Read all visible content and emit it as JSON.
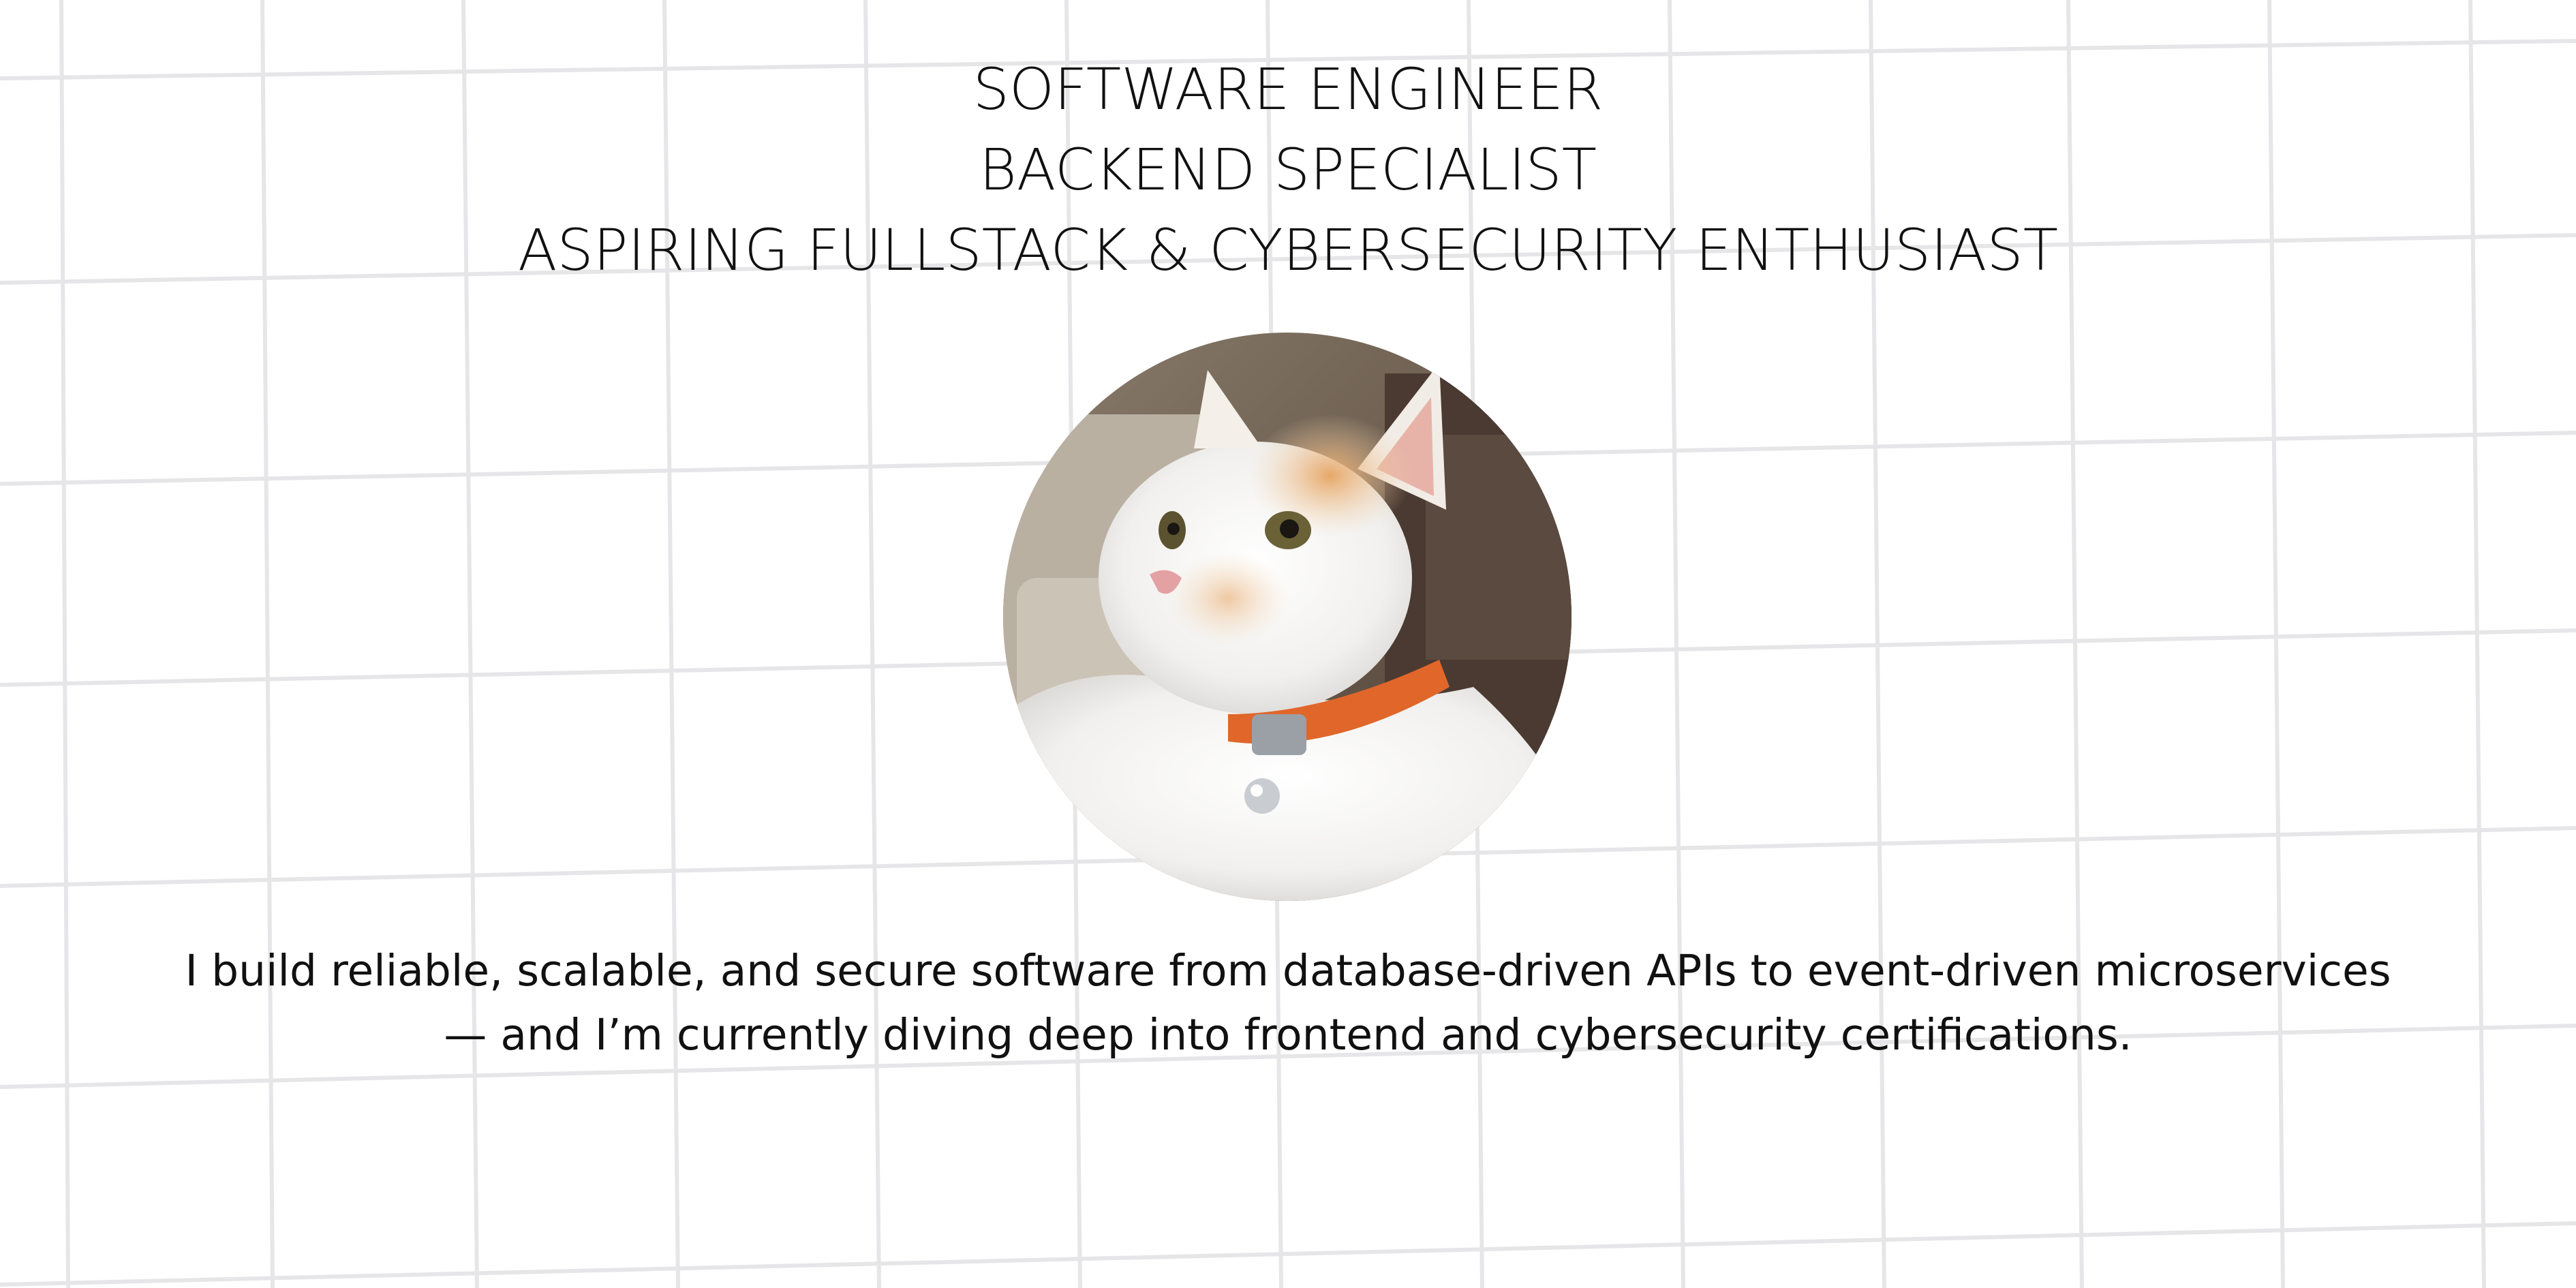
{
  "headline": {
    "line_1": "SOFTWARE ENGINEER",
    "line_2": "BACKEND SPECIALIST",
    "line_3": "ASPIRING FULLSTACK & CYBERSECURITY ENTHUSIAST"
  },
  "profile_photo": {
    "icon": "cat-photo",
    "subject": "white and orange cat wearing an orange collar with a bell"
  },
  "bio": {
    "line_1": "I build reliable, scalable, and secure software from database-driven APIs to event-driven microservices",
    "line_2": "— and I’m currently diving deep into frontend and cybersecurity certifications."
  },
  "colors": {
    "background": "#ffffff",
    "grid_lines": "#e6e6e8",
    "text": "#111111",
    "collar": "#e0662a"
  }
}
